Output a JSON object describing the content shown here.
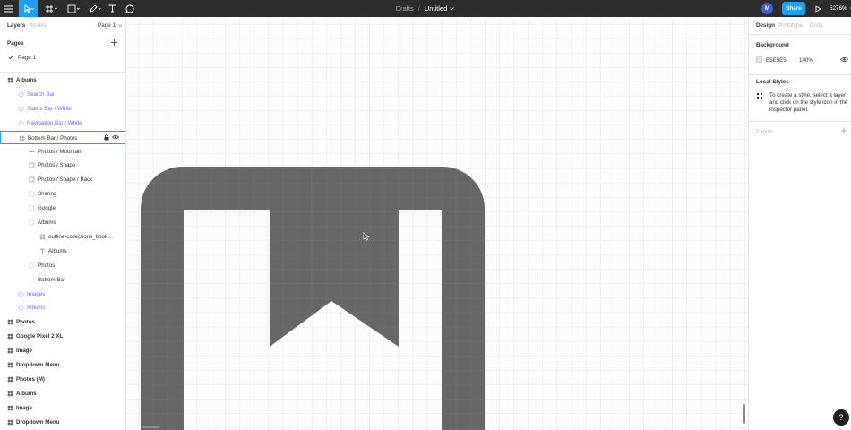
{
  "toolbar": {
    "breadcrumb": "Drafts",
    "separator": "/",
    "doc_title": "Untitled",
    "avatar_initial": "M",
    "share_label": "Share",
    "zoom": "5276%",
    "accent": "#18a0fb"
  },
  "left_panel": {
    "tab_layers": "Layers",
    "tab_assets": "Assets",
    "page_select": "Page 1",
    "pages_title": "Pages",
    "pages": [
      {
        "label": "Page 1",
        "current": true
      }
    ],
    "layers": [
      {
        "label": "Albums",
        "kind": "frame",
        "icon": "frame-icon"
      },
      {
        "label": "Search Bar",
        "kind": "comp",
        "icon": "instance-icon"
      },
      {
        "label": "Status Bar / White",
        "kind": "comp",
        "icon": "instance-icon"
      },
      {
        "label": "Navigation Bar / White",
        "kind": "comp",
        "icon": "instance-icon"
      },
      {
        "label": "Bottom Bar / Photos",
        "kind": "plain",
        "icon": "frame-icon",
        "selected": true
      },
      {
        "label": "Photos / Mountain",
        "kind": "plain",
        "icon": "line-icon"
      },
      {
        "label": "Photos / Shape",
        "kind": "plain",
        "icon": "rect-icon"
      },
      {
        "label": "Photos / Shape / Back",
        "kind": "plain",
        "icon": "rect-icon"
      },
      {
        "label": "Sharing",
        "kind": "plain",
        "icon": "group-icon"
      },
      {
        "label": "Google",
        "kind": "plain",
        "icon": "group-icon"
      },
      {
        "label": "Albums",
        "kind": "plain",
        "icon": "group-icon"
      },
      {
        "label": "outline-collections_bookmar...",
        "kind": "plain",
        "icon": "frame-icon"
      },
      {
        "label": "Albums",
        "kind": "plain",
        "icon": "text-icon"
      },
      {
        "label": "Photos",
        "kind": "plain",
        "icon": "group-icon"
      },
      {
        "label": "Bottom Bar",
        "kind": "plain",
        "icon": "line-icon"
      },
      {
        "label": "Images",
        "kind": "comp",
        "icon": "instance-icon"
      },
      {
        "label": "Albums",
        "kind": "comp",
        "icon": "instance-icon"
      },
      {
        "label": "Photos",
        "kind": "frame",
        "icon": "frame-icon"
      },
      {
        "label": "Google Pixel 2 XL",
        "kind": "frame",
        "icon": "frame-icon"
      },
      {
        "label": "Image",
        "kind": "frame",
        "icon": "frame-icon"
      },
      {
        "label": "Dropdown Menu",
        "kind": "frame",
        "icon": "frame-icon"
      },
      {
        "label": "Photos (M)",
        "kind": "frame",
        "icon": "frame-icon"
      },
      {
        "label": "Albums",
        "kind": "frame",
        "icon": "frame-icon"
      },
      {
        "label": "Image",
        "kind": "frame",
        "icon": "frame-icon"
      },
      {
        "label": "Dropdown Menu",
        "kind": "frame",
        "icon": "frame-icon"
      }
    ]
  },
  "right_panel": {
    "tab_design": "Design",
    "tab_prototype": "Prototype",
    "tab_code": "Code",
    "background_title": "Background",
    "background_hex": "E5E5E5",
    "background_color": "#e5e5e5",
    "background_opacity": "100%",
    "local_styles_title": "Local Styles",
    "local_styles_hint": "To create a style, select a layer and click on the style icon in the inspector panel.",
    "export_title": "Export"
  },
  "canvas": {
    "background": "#fcfcfc",
    "shape_color": "#676767"
  },
  "help_label": "?"
}
